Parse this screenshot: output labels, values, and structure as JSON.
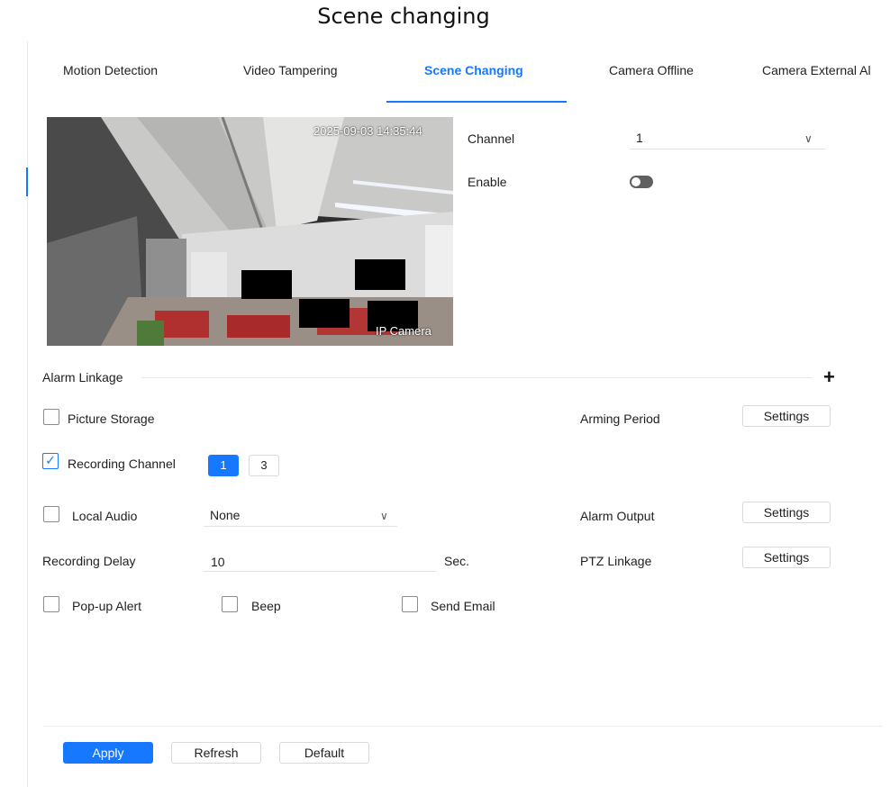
{
  "page": {
    "heading": "Scene changing"
  },
  "tabs": [
    {
      "label": "Motion Detection",
      "active": false
    },
    {
      "label": "Video Tampering",
      "active": false
    },
    {
      "label": "Scene Changing",
      "active": true
    },
    {
      "label": "Camera Offline",
      "active": false
    },
    {
      "label": "Camera External Al",
      "active": false
    }
  ],
  "preview": {
    "timestamp": "2025-09-03 14:35:44",
    "camera_name": "IP Camera"
  },
  "channel": {
    "label": "Channel",
    "value": "1"
  },
  "enable": {
    "label": "Enable",
    "on": false
  },
  "alarm_linkage": {
    "title": "Alarm Linkage",
    "picture_storage": {
      "label": "Picture Storage",
      "checked": false
    },
    "arming_period": {
      "label": "Arming Period",
      "button": "Settings"
    },
    "recording_channel": {
      "label": "Recording Channel",
      "checked": true,
      "channels": [
        "1",
        "3"
      ],
      "selected": "1"
    },
    "local_audio": {
      "label": "Local Audio",
      "checked": false,
      "value": "None"
    },
    "alarm_output": {
      "label": "Alarm Output",
      "button": "Settings"
    },
    "recording_delay": {
      "label": "Recording Delay",
      "value": "10",
      "unit": "Sec."
    },
    "ptz_linkage": {
      "label": "PTZ Linkage",
      "button": "Settings"
    },
    "popup_alert": {
      "label": "Pop-up Alert",
      "checked": false
    },
    "beep": {
      "label": "Beep",
      "checked": false
    },
    "send_email": {
      "label": "Send Email",
      "checked": false
    }
  },
  "footer": {
    "apply": "Apply",
    "refresh": "Refresh",
    "default": "Default"
  },
  "colors": {
    "accent": "#1677ff",
    "toggle_off": "#606060"
  },
  "icons": {
    "dropdown": "chevron-down-icon",
    "add": "plus-icon",
    "check": "checkmark-icon"
  }
}
